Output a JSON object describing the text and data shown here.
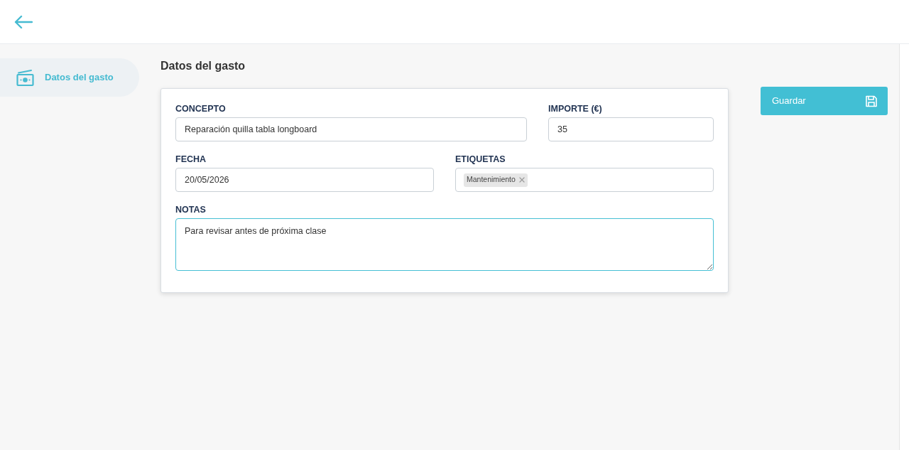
{
  "sidebar": {
    "items": [
      {
        "label": "Datos del gasto",
        "selected": true
      }
    ]
  },
  "section": {
    "title": "Datos del gasto"
  },
  "form": {
    "rows": [
      [
        {
          "kind": "text",
          "label": "CONCEPTO",
          "value": "Reparación quilla tabla longboard",
          "focused": false
        },
        {
          "kind": "number",
          "label": "IMPORTE (€)",
          "value": "35",
          "focused": false
        }
      ],
      [
        {
          "kind": "date",
          "label": "FECHA",
          "value": "20/05/2026",
          "focused": false
        },
        {
          "kind": "tags",
          "label": "ETIQUETAS",
          "tags": [
            "Mantenimiento"
          ],
          "focused": false
        }
      ],
      [
        {
          "kind": "textarea",
          "label": "NOTAS",
          "value": "Para revisar antes de próxima clase",
          "focused": true
        }
      ]
    ]
  },
  "actions": {
    "save_button": {
      "label": "Guardar"
    }
  }
}
